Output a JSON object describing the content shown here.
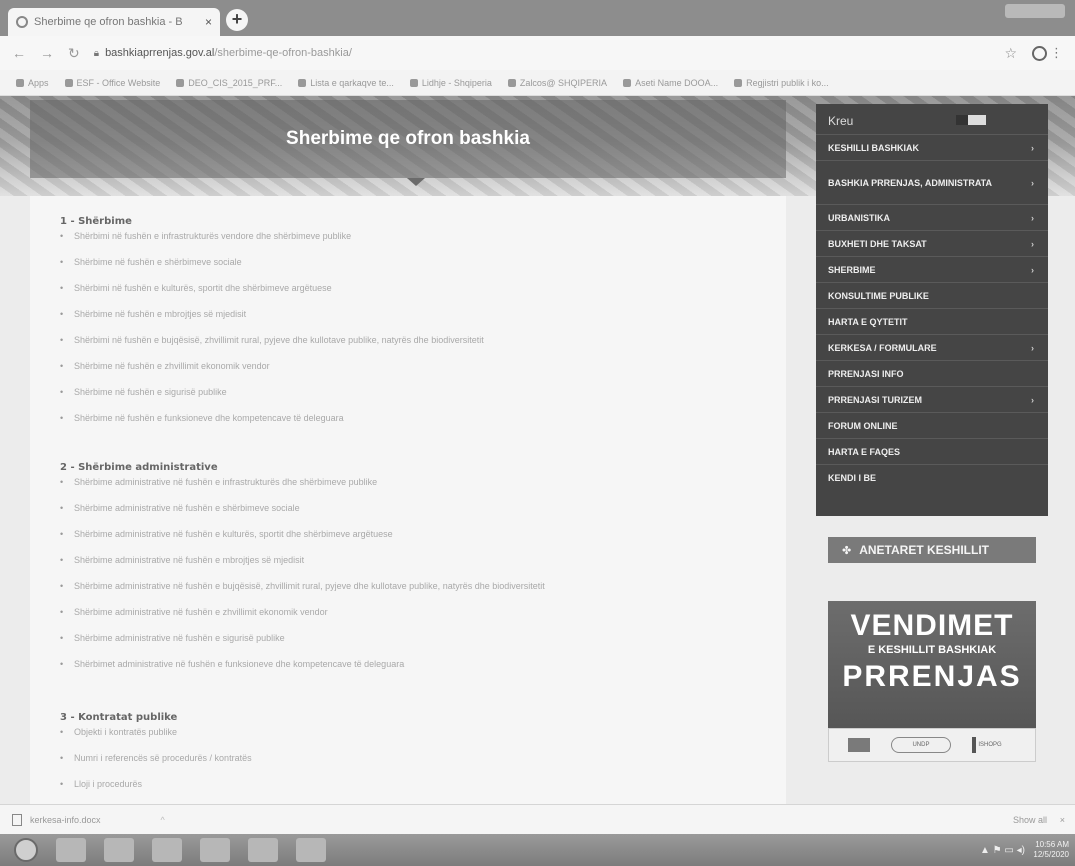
{
  "browser": {
    "tab_title": "Sherbime qe ofron bashkia - B",
    "tab_close": "×",
    "new_tab": "+",
    "url_domain": "bashkiaprrenjas.gov.al",
    "url_path": "/sherbime-qe-ofron-bashkia/",
    "bookmarks": [
      "Apps",
      "ESF - Office Website",
      "DEO_CIS_2015_PRF...",
      "Lista e qarkaqve te...",
      "Lidhje - Shqiperia",
      "Zalcos@ SHQIPERIA",
      "Aseti Name DOOA...",
      "Regjistri publik i ko..."
    ]
  },
  "banner": {
    "title": "Sherbime qe ofron bashkia"
  },
  "sections": [
    {
      "heading": "1 - Shërbime",
      "items": [
        "Shërbimi në fushën e infrastrukturës vendore dhe shërbimeve publike",
        "Shërbime në fushën e shërbimeve sociale",
        "Shërbimi në fushën e kulturës, sportit dhe shërbimeve argëtuese",
        "Shërbime në fushën e mbrojtjes së mjedisit",
        "Shërbimi në fushën e bujqësisë, zhvillimit rural, pyjeve dhe kullotave publike, natyrës dhe biodiversitetit",
        "Shërbime në fushën e zhvillimit ekonomik vendor",
        "Shërbime në fushën e sigurisë publike",
        "Shërbime në fushën e funksioneve dhe kompetencave të deleguara"
      ]
    },
    {
      "heading": "2 - Shërbime administrative",
      "items": [
        "Shërbime administrative në fushën e infrastrukturës dhe shërbimeve publike",
        "Shërbime administrative në fushën e shërbimeve sociale",
        "Shërbime administrative në fushën e kulturës, sportit dhe shërbimeve argëtuese",
        "Shërbime administrative në fushën e mbrojtjes së mjedisit",
        "Shërbime administrative në fushën e bujqësisë, zhvillimit rural, pyjeve dhe kullotave publike, natyrës dhe biodiversitetit",
        "Shërbime administrative në fushën e zhvillimit ekonomik vendor",
        "Shërbime administrative në fushën e sigurisë publike",
        "Shërbimet administrative në fushën e funksioneve dhe kompetencave të deleguara"
      ]
    },
    {
      "heading": "3 - Kontratat publike",
      "items": [
        "Objekti i kontratës publike",
        "Numri i referencës së procedurës / kontratës",
        "Lloji i procedurës"
      ]
    }
  ],
  "menu": {
    "home": "Kreu",
    "items": [
      {
        "label": "KESHILLI BASHKIAK",
        "chevron": "›"
      },
      {
        "label": "BASHKIA PRRENJAS, ADMINISTRATA",
        "chevron": "›"
      },
      {
        "label": "URBANISTIKA",
        "chevron": "›"
      },
      {
        "label": "BUXHETI DHE TAKSAT",
        "chevron": "›"
      },
      {
        "label": "SHERBIME",
        "chevron": "›"
      },
      {
        "label": "KONSULTIME PUBLIKE",
        "chevron": ""
      },
      {
        "label": "HARTA E QYTETIT",
        "chevron": ""
      },
      {
        "label": "KERKESA / FORMULARE",
        "chevron": "›"
      },
      {
        "label": "PRRENJASI INFO",
        "chevron": ""
      },
      {
        "label": "PRRENJASI TURIZEM",
        "chevron": "›"
      },
      {
        "label": "FORUM ONLINE",
        "chevron": ""
      },
      {
        "label": "HARTA E FAQES",
        "chevron": ""
      },
      {
        "label": "KENDI I BE",
        "chevron": ""
      }
    ]
  },
  "widgets": {
    "anetaret": "ANETARET KESHILLIT",
    "vendimet_1": "VENDIMET",
    "vendimet_2": "E KESHILLIT BASHKIAK",
    "vendimet_3": "PRRENJAS",
    "logo_oval": "UNDP",
    "logo_mark": "ISHOPG"
  },
  "download": {
    "file": "kerkesa-info.docx",
    "arrow": "^",
    "show_all": "Show all",
    "close": "×"
  },
  "taskbar": {
    "tray": "▲ ⚑ ▭ ◂)",
    "time": "10:56 AM",
    "date": "12/5/2020"
  }
}
